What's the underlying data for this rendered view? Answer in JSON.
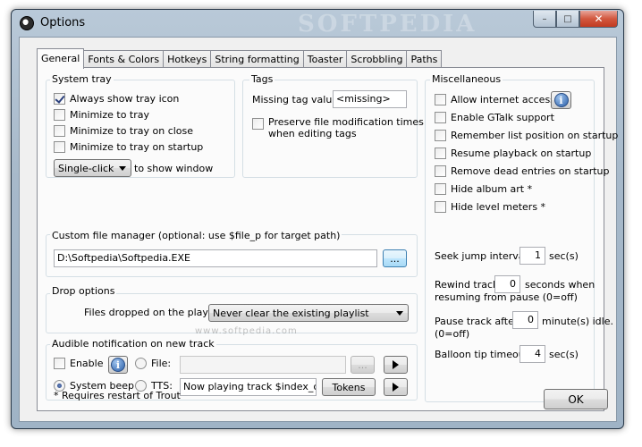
{
  "window": {
    "title": "Options",
    "watermark": "SOFTPEDIA",
    "minimize_glyph": "–",
    "maximize_glyph": "□",
    "close_glyph": "✕"
  },
  "tabs": [
    "General",
    "Fonts & Colors",
    "Hotkeys",
    "String formatting",
    "Toaster",
    "Scrobbling",
    "Paths"
  ],
  "system_tray": {
    "label": "System tray",
    "options": [
      {
        "label": "Always show tray icon",
        "checked": true
      },
      {
        "label": "Minimize to tray",
        "checked": false
      },
      {
        "label": "Minimize to tray on close",
        "checked": false
      },
      {
        "label": "Minimize to tray on startup",
        "checked": false
      }
    ],
    "click_mode": "Single-click",
    "click_suffix": "to show window"
  },
  "tags": {
    "label": "Tags",
    "missing_label": "Missing tag value:",
    "missing_value": "<missing>",
    "preserve_line1": "Preserve file modification times",
    "preserve_line2": "when editing tags",
    "preserve_checked": false
  },
  "file_manager": {
    "label": "Custom file manager (optional: use $file_p for target path)",
    "value": "D:\\Softpedia\\Softpedia.EXE",
    "browse_label": "..."
  },
  "drop_options": {
    "label": "Drop options",
    "files_dropped_label": "Files dropped on the playlist:",
    "selected": "Never clear the existing playlist"
  },
  "notification": {
    "label": "Audible notification on new track",
    "enable_label": "Enable",
    "enable_checked": false,
    "file_label": "File:",
    "file_value": "",
    "file_browse": "...",
    "beep_label": "System beep",
    "tts_label": "TTS:",
    "tts_value": "Now playing track $index_c of $",
    "tokens_label": "Tokens",
    "selected_mode": "System beep"
  },
  "misc": {
    "label": "Miscellaneous",
    "options": [
      {
        "label": "Allow internet access",
        "checked": false
      },
      {
        "label": "Enable GTalk support",
        "checked": false
      },
      {
        "label": "Remember list position on startup",
        "checked": false
      },
      {
        "label": "Resume playback on startup",
        "checked": false
      },
      {
        "label": "Remove dead entries on startup",
        "checked": false
      },
      {
        "label": "Hide album art *",
        "checked": false
      },
      {
        "label": "Hide level meters *",
        "checked": false
      }
    ],
    "seek_label": "Seek jump interval:",
    "seek_value": "1",
    "seek_unit": "sec(s)",
    "rewind_label": "Rewind track",
    "rewind_value": "0",
    "rewind_suffix1": "seconds when",
    "rewind_suffix2": "resuming from pause (0=off)",
    "pause_label": "Pause track after",
    "pause_value": "0",
    "pause_suffix1": "minute(s) idle.",
    "pause_suffix2": "(0=off)",
    "balloon_label": "Balloon tip timeout:",
    "balloon_value": "4",
    "balloon_unit": "sec(s)"
  },
  "footer": {
    "note": "* Requires restart of Trout",
    "ok_label": "OK"
  },
  "watermark_center": "www.softpedia.com"
}
